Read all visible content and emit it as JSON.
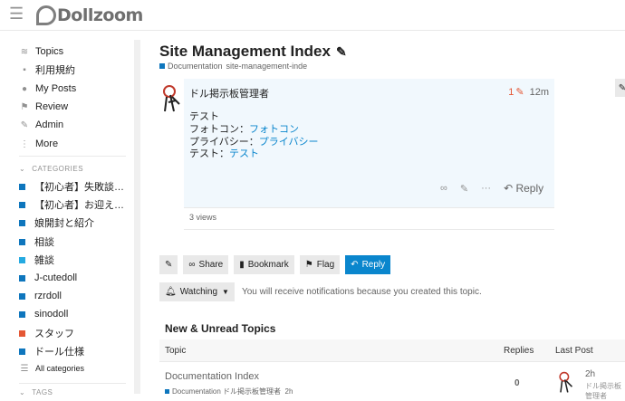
{
  "header": {
    "logo_text": "Dollzoom"
  },
  "sidebar": {
    "items": [
      {
        "label": "Topics",
        "icon": "layers-icon"
      },
      {
        "label": "利用規約",
        "icon": "comments-icon"
      },
      {
        "label": "My Posts",
        "icon": "user-icon"
      },
      {
        "label": "Review",
        "icon": "flag-icon"
      },
      {
        "label": "Admin",
        "icon": "wrench-icon"
      },
      {
        "label": "More",
        "icon": "more-vertical-icon"
      }
    ],
    "categories_heading": "CATEGORIES",
    "categories": [
      {
        "label": "【初心者】失敗談…",
        "color": "#0e76bd"
      },
      {
        "label": "【初心者】お迎え…",
        "color": "#0e76bd"
      },
      {
        "label": "娘開封と紹介",
        "color": "#0e76bd"
      },
      {
        "label": "相談",
        "color": "#0e76bd"
      },
      {
        "label": "雑談",
        "color": "#25aae1"
      },
      {
        "label": "J-cutedoll",
        "color": "#0e76bd"
      },
      {
        "label": "rzrdoll",
        "color": "#0e76bd"
      },
      {
        "label": "sinodoll",
        "color": "#0e76bd"
      },
      {
        "label": "スタッフ",
        "color": "#e45735"
      },
      {
        "label": "ドール仕様",
        "color": "#0e76bd"
      }
    ],
    "all_categories": "All categories",
    "tags_heading": "TAGS"
  },
  "topic": {
    "title": "Site Management Index",
    "category": "Documentation",
    "category_color": "#0e76bd",
    "tag": "site-management-inde"
  },
  "post": {
    "author": "ドル掲示板管理者",
    "edit_count": "1",
    "age": "12m",
    "line1": "テスト",
    "line2_label": "フォトコン：",
    "line2_link": "フォトコン",
    "line3_label": "プライバシー：",
    "line3_link": "プライバシー",
    "line4_label": "テスト：",
    "line4_link": "テスト",
    "reply_label": "Reply",
    "views": "3 views"
  },
  "buttons": {
    "share": "Share",
    "bookmark": "Bookmark",
    "flag": "Flag",
    "reply": "Reply"
  },
  "notifications": {
    "level": "Watching",
    "message": "You will receive notifications because you created this topic."
  },
  "suggested": {
    "heading": "New & Unread Topics",
    "columns": [
      "Topic",
      "Replies",
      "Last Post"
    ],
    "rows": [
      {
        "title": "Documentation Index",
        "category": "Documentation",
        "author": "ドル掲示板管理者",
        "age": "2h",
        "replies": "0",
        "last_age": "2h",
        "last_user": "ドル掲示板管理者"
      }
    ]
  },
  "colors": {
    "accent": "#0a86cd",
    "post_bg": "#f1f8fd"
  }
}
